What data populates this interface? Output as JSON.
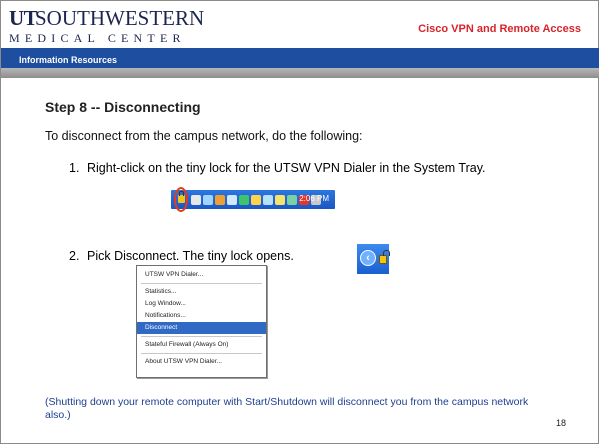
{
  "header": {
    "logo_ut": "UT",
    "logo_name": "SOUTHWESTERN",
    "logo_sub": "MEDICAL CENTER",
    "title": "Cisco VPN and Remote Access",
    "bar_text": "Information Resources",
    "title_color": "#d8232a",
    "bar_color": "#1d4ea0"
  },
  "content": {
    "step_title": "Step 8 -- Disconnecting",
    "intro": "To disconnect from the campus network, do the following:",
    "items": [
      {
        "num": "1.",
        "text": "Right-click on the tiny lock for the UTSW VPN Dialer in the System Tray."
      },
      {
        "num": "2.",
        "text": "Pick Disconnect.  The tiny lock opens."
      }
    ],
    "tray_clock": "2:06 PM",
    "menu_items": [
      "UTSW VPN Dialer...",
      "Statistics...",
      "Log Window...",
      "Notifications...",
      "Disconnect",
      "Stateful Firewall (Always On)",
      "About UTSW VPN Dialer..."
    ],
    "note": "(Shutting down your remote computer with Start/Shutdown will disconnect you from the campus network also.)",
    "page_number": "18"
  }
}
